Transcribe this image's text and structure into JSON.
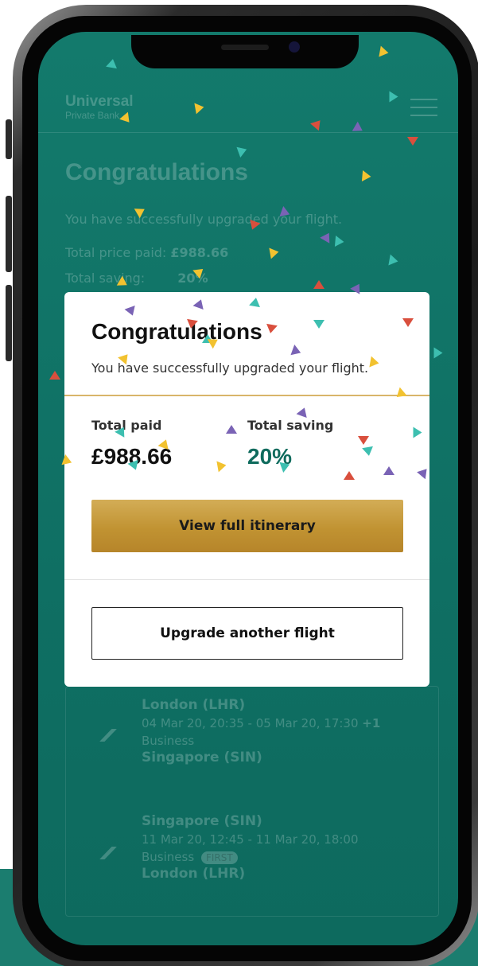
{
  "background_page": {
    "logo_top": "Universal",
    "logo_bottom": "Private Bank",
    "title": "Congratulations",
    "message": "You have successfully upgraded your flight.",
    "total_price_label": "Total price paid:",
    "total_price_value": "£988.66",
    "total_saving_label": "Total saving:",
    "total_saving_value": "20%",
    "flights": [
      {
        "from": "London (LHR)",
        "times": "04 Mar 20, 20:35 - 05 Mar 20, 17:30",
        "day_offset": "+1",
        "cabin": "Business",
        "badge": "",
        "to": "Singapore (SIN)"
      },
      {
        "from": "Singapore (SIN)",
        "times": "11 Mar 20, 12:45 - 11 Mar 20, 18:00",
        "day_offset": "",
        "cabin": "Business",
        "badge": "FIRST",
        "to": "London (LHR)"
      }
    ]
  },
  "modal": {
    "title": "Congratulations",
    "subtitle": "You have successfully upgraded your flight.",
    "total_paid_label": "Total paid",
    "total_paid_value": "£988.66",
    "total_saving_label": "Total saving",
    "total_saving_value": "20%",
    "primary_button": "View full itinerary",
    "secondary_button": "Upgrade another flight"
  },
  "colors": {
    "screen_teal": "#137a6c",
    "accent_gold": "#c79a3a",
    "saving_green": "#0f6b5d",
    "confetti": [
      "#f2c230",
      "#7a63b5",
      "#d94f3d",
      "#3dbfb0",
      "#e0a33a"
    ]
  }
}
